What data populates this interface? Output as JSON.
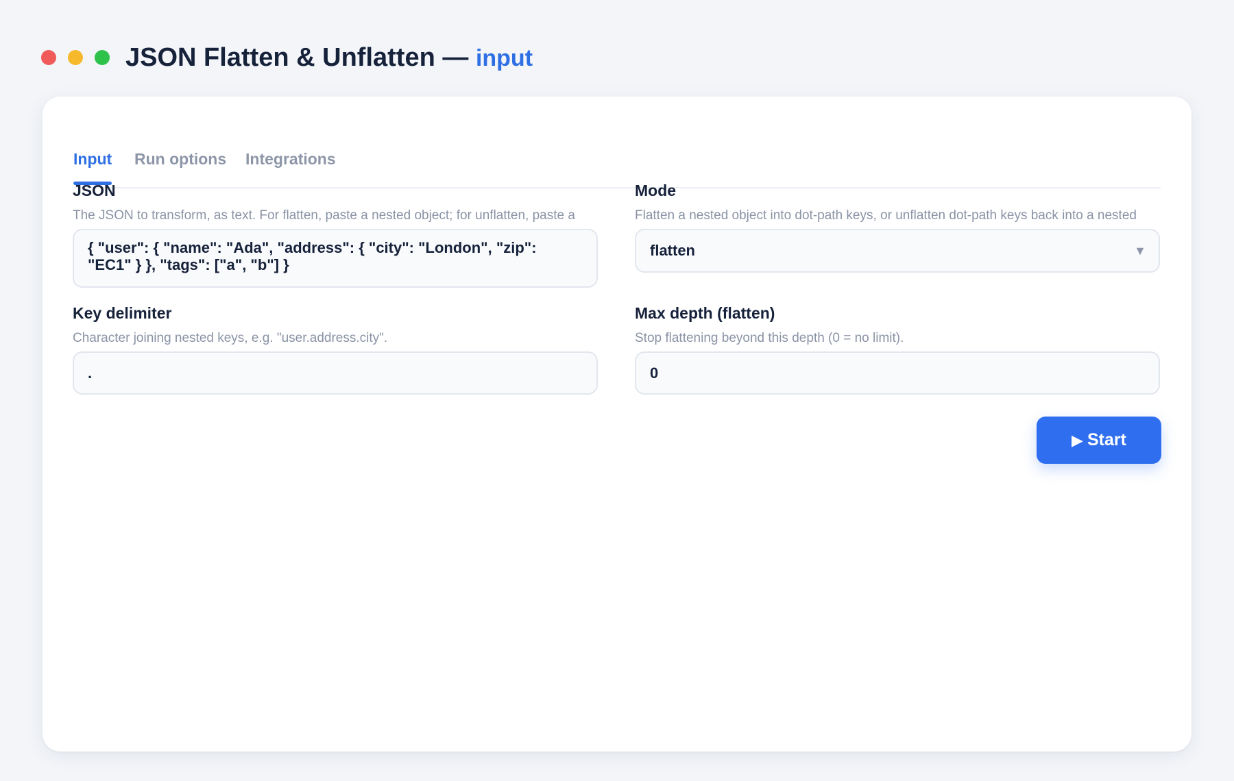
{
  "window": {
    "title": "JSON Flatten & Unflatten —",
    "title_accent": "input",
    "colors": {
      "close": "#f05a5a",
      "minimize": "#f6b92b",
      "maximize": "#2ec24a",
      "accent": "#2f6fe4"
    }
  },
  "tabs": [
    {
      "label": "Input",
      "active": true
    },
    {
      "label": "Run options",
      "active": false
    },
    {
      "label": "Integrations",
      "active": false
    }
  ],
  "form": {
    "json": {
      "label": "JSON",
      "help": "The JSON to transform, as text. For flatten, paste a nested object; for unflatten, paste a",
      "value": "{ \"user\": { \"name\": \"Ada\", \"address\": { \"city\": \"London\", \"zip\": \"EC1\" } }, \"tags\": [\"a\", \"b\"] }"
    },
    "mode": {
      "label": "Mode",
      "help": "Flatten a nested object into dot-path keys, or unflatten dot-path keys back into a nested",
      "value": "flatten",
      "icon": "chevron-down-icon"
    },
    "delimiter": {
      "label": "Key delimiter",
      "help": "Character joining nested keys, e.g. \"user.address.city\".",
      "value": "."
    },
    "max_depth": {
      "label": "Max depth (flatten)",
      "help": "Stop flattening beyond this depth (0 = no limit).",
      "value": "0"
    }
  },
  "actions": {
    "start_icon": "▶",
    "start_label": "Start"
  }
}
